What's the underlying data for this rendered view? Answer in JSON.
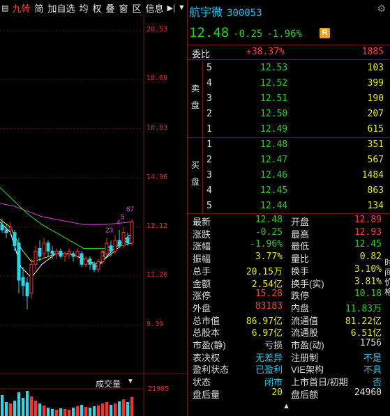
{
  "toolbar": {
    "items": [
      "九转",
      "简",
      "加自选",
      "均",
      "权",
      "叠",
      "窗",
      "区",
      "信息"
    ],
    "active_index": 0
  },
  "chart": {
    "price_ticks": [
      "20.53",
      "18.69",
      "16.83",
      "14.96",
      "13.12",
      "11.26",
      "9.39"
    ],
    "volume_title": "成交量",
    "volume_axis": "21905",
    "marker_labels": [
      "1",
      "23",
      "4",
      "5",
      "67",
      "1"
    ],
    "colors": {
      "up": "#ff3030",
      "down": "#28d8e8",
      "ma5": "#ffffff",
      "ma10": "#e8e820",
      "ma20": "#e040e0",
      "ma60": "#20e020"
    }
  },
  "stock": {
    "name": "航宇微",
    "code": "300053",
    "price": "12.48",
    "change": "-0.25",
    "change_pct": "-1.96%",
    "badge": "R"
  },
  "weibi": {
    "label": "委比",
    "pct": "+38.37%",
    "count": "1885"
  },
  "sell": {
    "side_label": [
      "卖",
      "盘"
    ],
    "rows": [
      {
        "level": "5",
        "price": "12.53",
        "volume": "103"
      },
      {
        "level": "4",
        "price": "12.52",
        "volume": "399"
      },
      {
        "level": "3",
        "price": "12.51",
        "volume": "190"
      },
      {
        "level": "2",
        "price": "12.50",
        "volume": "207"
      },
      {
        "level": "1",
        "price": "12.49",
        "volume": "615"
      }
    ]
  },
  "buy": {
    "side_label": [
      "买",
      "盘"
    ],
    "rows": [
      {
        "level": "1",
        "price": "12.48",
        "volume": "351"
      },
      {
        "level": "2",
        "price": "12.47",
        "volume": "567"
      },
      {
        "level": "3",
        "price": "12.46",
        "volume": "1484"
      },
      {
        "level": "4",
        "price": "12.45",
        "volume": "863"
      },
      {
        "level": "5",
        "price": "12.44",
        "volume": "134"
      }
    ]
  },
  "stats": [
    {
      "l1": "最新",
      "v1": "12.48",
      "c1": "green",
      "l2": "开盘",
      "v2": "12.89",
      "c2": "red"
    },
    {
      "l1": "涨跌",
      "v1": "-0.25",
      "c1": "green",
      "l2": "最高",
      "v2": "12.93",
      "c2": "red"
    },
    {
      "l1": "涨幅",
      "v1": "-1.96%",
      "c1": "green",
      "l2": "最低",
      "v2": "12.45",
      "c2": "green"
    },
    {
      "l1": "振幅",
      "v1": "3.77%",
      "c1": "yellow",
      "l2": "量比",
      "v2": "0.82",
      "c2": "yellow"
    },
    {
      "l1": "总手",
      "v1": "20.15万",
      "c1": "yellow",
      "l2": "换手",
      "v2": "3.10%",
      "c2": "yellow"
    },
    {
      "l1": "金额",
      "v1": "2.54亿",
      "c1": "yellow",
      "l2": "换手(实)",
      "v2": "3.81%",
      "c2": "yellow"
    },
    {
      "l1": "涨停",
      "v1": "15.28",
      "c1": "red",
      "l2": "跌停",
      "v2": "10.18",
      "c2": "green"
    },
    {
      "l1": "外盘",
      "v1": "83183",
      "c1": "red",
      "l2": "内盘",
      "v2": "11.83万",
      "c2": "green"
    },
    {
      "l1": "总市值",
      "v1": "86.97亿",
      "c1": "yellow",
      "l2": "流通值",
      "v2": "81.22亿",
      "c2": "yellow"
    },
    {
      "l1": "总股本",
      "v1": "6.97亿",
      "c1": "yellow",
      "l2": "流通股",
      "v2": "6.51亿",
      "c2": "yellow"
    },
    {
      "l1": "市盈(静)",
      "v1": "亏损",
      "c1": "white",
      "l2": "市盈(动)",
      "v2": "1756",
      "c2": "white"
    },
    {
      "l1": "表决权",
      "v1": "无差异",
      "c1": "cyan",
      "l2": "注册制",
      "v2": "不是",
      "c2": "cyan"
    },
    {
      "l1": "盈利状态",
      "v1": "已盈利",
      "c1": "cyan",
      "l2": "VIE架构",
      "v2": "不具",
      "c2": "cyan"
    },
    {
      "l1": "状态",
      "v1": "闭市",
      "c1": "cyan",
      "l2": "上市首日/初期",
      "v2": "否",
      "c2": "cyan"
    },
    {
      "l1": "盘后量",
      "v1": "20",
      "c1": "yellow",
      "l2": "盘后额",
      "v2": "24960",
      "c2": "white"
    }
  ],
  "edge_chars": [
    "时",
    "间",
    "价",
    "格"
  ]
}
